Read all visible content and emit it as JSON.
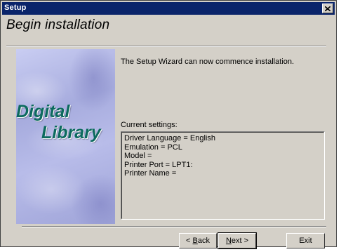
{
  "window": {
    "title": "Setup",
    "close_icon": "close-icon"
  },
  "page": {
    "heading": "Begin installation"
  },
  "art": {
    "logo_line1": "Digital",
    "logo_line2": "Library"
  },
  "main": {
    "intro": "The Setup Wizard can now commence installation.",
    "settings_label": "Current settings:",
    "settings": [
      "Driver Language = English",
      "Emulation = PCL",
      "Model =",
      "Printer Port = LPT1:",
      "Printer Name ="
    ]
  },
  "buttons": {
    "back": {
      "prefix": "< ",
      "accel": "B",
      "rest": "ack"
    },
    "next": {
      "accel": "N",
      "rest": "ext >"
    },
    "exit": "Exit"
  }
}
